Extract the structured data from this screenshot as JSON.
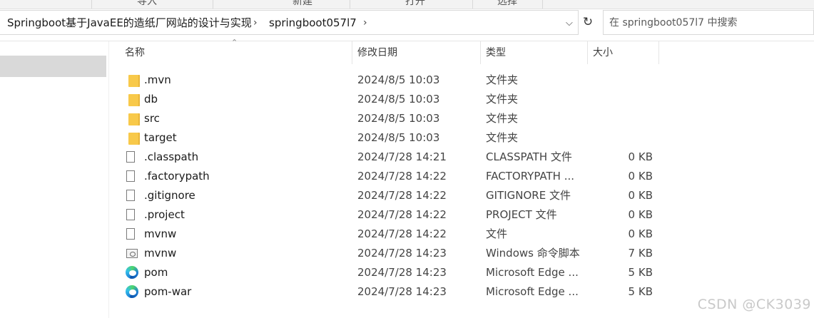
{
  "ribbon": [
    "导入",
    "新建",
    "打开",
    "选择"
  ],
  "breadcrumb": {
    "items": [
      "Springboot基于JavaEE的造纸厂网站的设计与实现",
      "springboot057l7"
    ]
  },
  "search": {
    "placeholder": "在 springboot057l7 中搜索"
  },
  "columns": {
    "name": "名称",
    "date": "修改日期",
    "type": "类型",
    "size": "大小"
  },
  "files": [
    {
      "name": ".mvn",
      "date": "2024/8/5 10:03",
      "type": "文件夹",
      "size": "",
      "icon": "folder-icon"
    },
    {
      "name": "db",
      "date": "2024/8/5 10:03",
      "type": "文件夹",
      "size": "",
      "icon": "folder-icon"
    },
    {
      "name": "src",
      "date": "2024/8/5 10:03",
      "type": "文件夹",
      "size": "",
      "icon": "folder-icon"
    },
    {
      "name": "target",
      "date": "2024/8/5 10:03",
      "type": "文件夹",
      "size": "",
      "icon": "folder-icon"
    },
    {
      "name": ".classpath",
      "date": "2024/7/28 14:21",
      "type": "CLASSPATH 文件",
      "size": "0 KB",
      "icon": "file-icon"
    },
    {
      "name": ".factorypath",
      "date": "2024/7/28 14:22",
      "type": "FACTORYPATH ...",
      "size": "0 KB",
      "icon": "file-icon"
    },
    {
      "name": ".gitignore",
      "date": "2024/7/28 14:22",
      "type": "GITIGNORE 文件",
      "size": "0 KB",
      "icon": "file-icon"
    },
    {
      "name": ".project",
      "date": "2024/7/28 14:22",
      "type": "PROJECT 文件",
      "size": "0 KB",
      "icon": "file-icon"
    },
    {
      "name": "mvnw",
      "date": "2024/7/28 14:22",
      "type": "文件",
      "size": "0 KB",
      "icon": "file-icon"
    },
    {
      "name": "mvnw",
      "date": "2024/7/28 14:23",
      "type": "Windows 命令脚本",
      "size": "7 KB",
      "icon": "script-icon"
    },
    {
      "name": "pom",
      "date": "2024/7/28 14:23",
      "type": "Microsoft Edge ...",
      "size": "5 KB",
      "icon": "edge-icon"
    },
    {
      "name": "pom-war",
      "date": "2024/7/28 14:23",
      "type": "Microsoft Edge ...",
      "size": "5 KB",
      "icon": "edge-icon"
    }
  ],
  "watermark": "CSDN @CK3039"
}
